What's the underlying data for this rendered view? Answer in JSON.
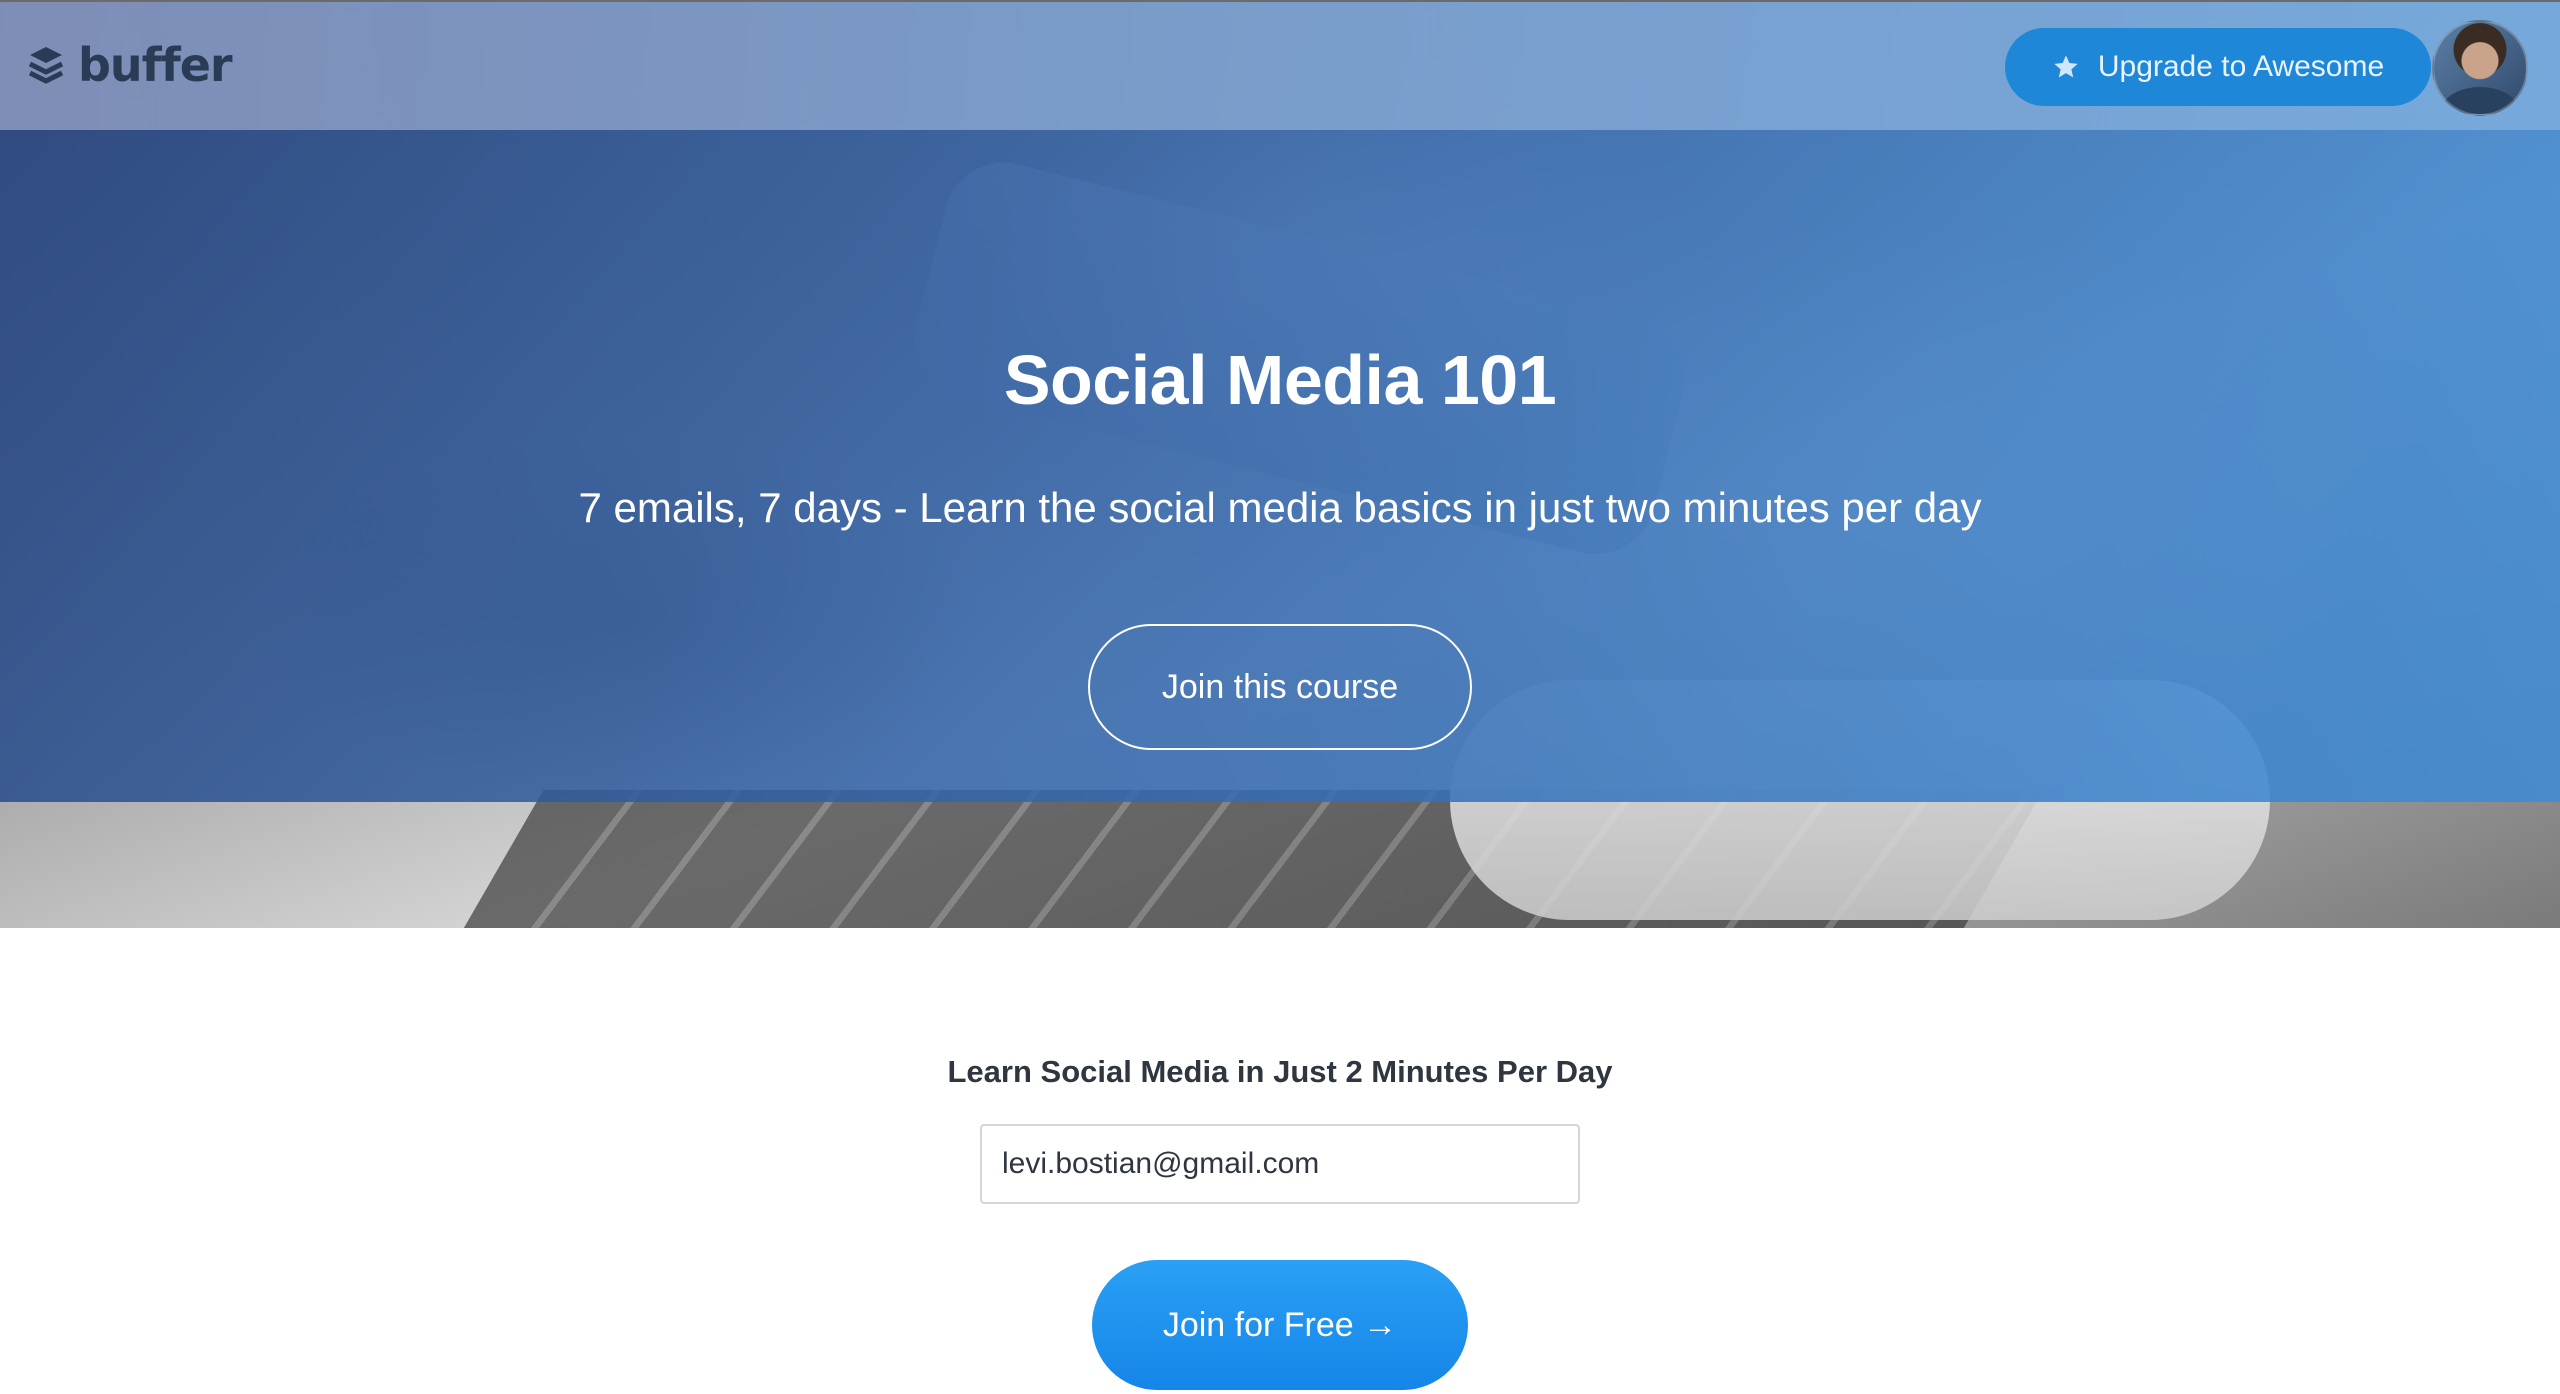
{
  "header": {
    "logo_text": "buffer",
    "upgrade_label": "Upgrade to Awesome",
    "upgrade_icon": "star-icon"
  },
  "hero": {
    "title": "Social Media 101",
    "subtitle": "7 emails, 7 days - Learn the social media basics in just two minutes per day",
    "cta_label": "Join this course"
  },
  "signup": {
    "heading": "Learn Social Media in Just 2 Minutes Per Day",
    "email_value": "levi.bostian@gmail.com",
    "button_label": "Join for Free →"
  },
  "colors": {
    "brand_dark": "#2a3b55",
    "primary_blue": "#1f87d8",
    "cta_blue": "#1585e8",
    "hero_overlay": "#3264aa"
  }
}
